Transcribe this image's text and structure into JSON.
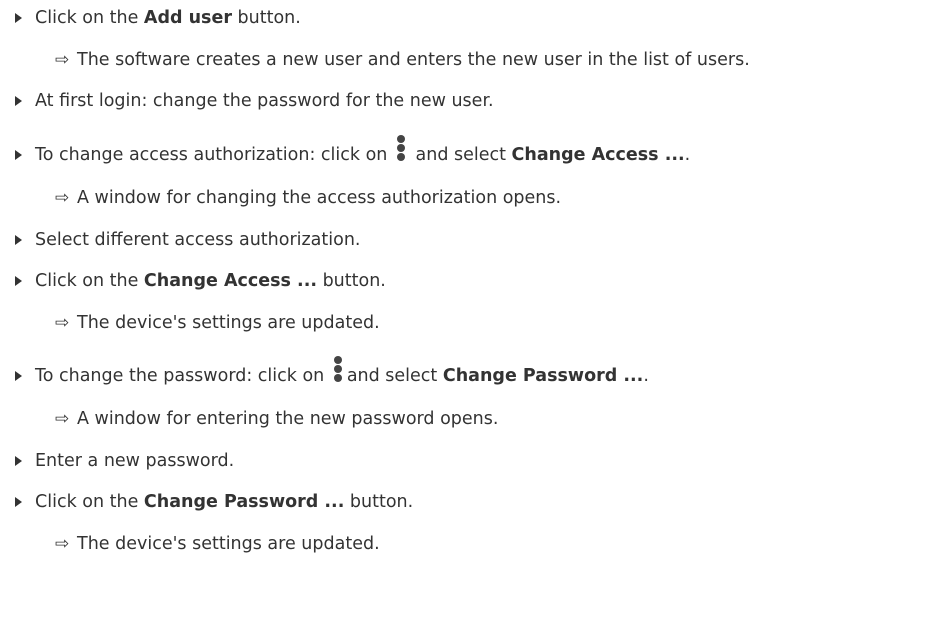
{
  "instructions": {
    "step1": {
      "pre": "Click on the ",
      "bold": "Add user",
      "post": " button."
    },
    "result1": "The software creates a new user and enters the new user in the list of users.",
    "step2": "At first login: change the password for the new user.",
    "step3": {
      "pre": "To change access authorization: click on ",
      "mid": " and select ",
      "bold": "Change Access ...",
      "post": "."
    },
    "result3": "A window for changing the access authorization opens.",
    "step4": "Select different access authorization.",
    "step5": {
      "pre": "Click on the ",
      "bold": "Change Access ...",
      "post": " button."
    },
    "result5": "The device's settings are updated.",
    "step6": {
      "pre": "To change the password: click on ",
      "mid": "and select ",
      "bold": "Change Password ...",
      "post": "."
    },
    "result6": "A window for entering the new password opens.",
    "step7": "Enter a new password.",
    "step8": {
      "pre": "Click on the ",
      "bold": "Change Password ...",
      "post": " button."
    },
    "result8": "The device's settings are updated."
  },
  "icons": {
    "bullet": "play-triangle-icon",
    "result_arrow": "hollow-right-arrow-icon",
    "menu": "kebab-menu-icon"
  },
  "colors": {
    "text": "#333333",
    "icon": "#444444"
  }
}
